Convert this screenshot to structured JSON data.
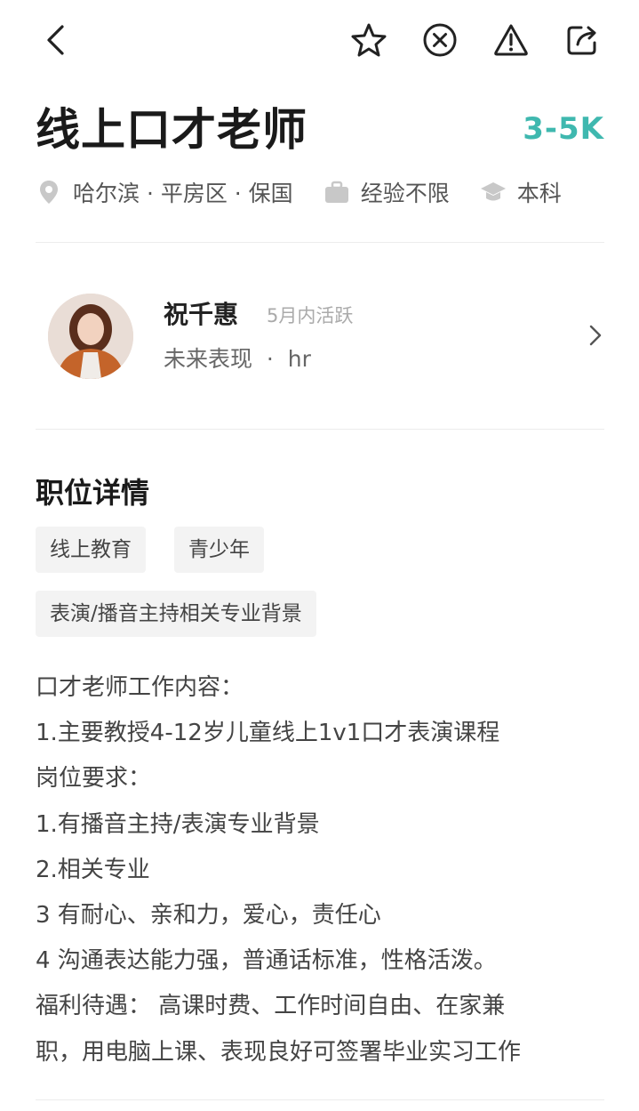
{
  "topbar": {
    "back_icon": "chevron-left-icon",
    "actions": [
      "star-icon",
      "close-circle-icon",
      "warning-icon",
      "share-icon"
    ]
  },
  "job": {
    "title": "线上口才老师",
    "salary": "3-5K",
    "location": "哈尔滨 · 平房区 · 保国",
    "experience": "经验不限",
    "education": "本科"
  },
  "recruiter": {
    "name": "祝千惠",
    "active": "5月内活跃",
    "company": "未来表现  ·  hr"
  },
  "details": {
    "section_title": "职位详情",
    "tags": [
      "线上教育",
      "青少年",
      "表演/播音主持相关专业背景"
    ],
    "lines": [
      "口才老师工作内容：",
      "1.主要教授4-12岁儿童线上1v1口才表演课程",
      "岗位要求：",
      "1.有播音主持/表演专业背景",
      "2.相关专业",
      "3 有耐心、亲和力，爱心，责任心",
      "4 沟通表达能力强，普通话标准，性格活泼。",
      "福利待遇： 高课时费、工作时间自由、在家兼",
      "职，用电脑上课、表现良好可签署毕业实习工作"
    ]
  },
  "colors": {
    "accent": "#3fb8af",
    "icon_gray": "#c8c8c8",
    "text_dark": "#1a1a1a"
  }
}
